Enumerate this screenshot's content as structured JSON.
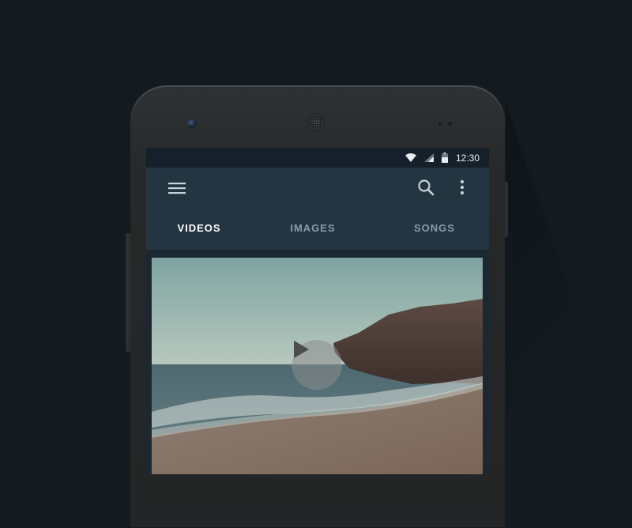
{
  "statusbar": {
    "time": "12:30",
    "icons": [
      "wifi-icon",
      "signal-icon",
      "battery-icon"
    ]
  },
  "toolbar": {
    "icons": [
      "menu-icon",
      "search-icon",
      "more-vertical-icon"
    ]
  },
  "tabs": [
    {
      "label": "VIDEOS",
      "active": true
    },
    {
      "label": "IMAGES",
      "active": false
    },
    {
      "label": "SONGS",
      "active": false
    }
  ],
  "media": {
    "type": "video",
    "control_icon": "play-icon"
  },
  "colors": {
    "background": "#141b20",
    "appbar": "#243542",
    "statusbar": "#16202a",
    "accent": "#41c7d2",
    "tab_active": "#ffffff",
    "tab_inactive": "#8a9aa6"
  }
}
